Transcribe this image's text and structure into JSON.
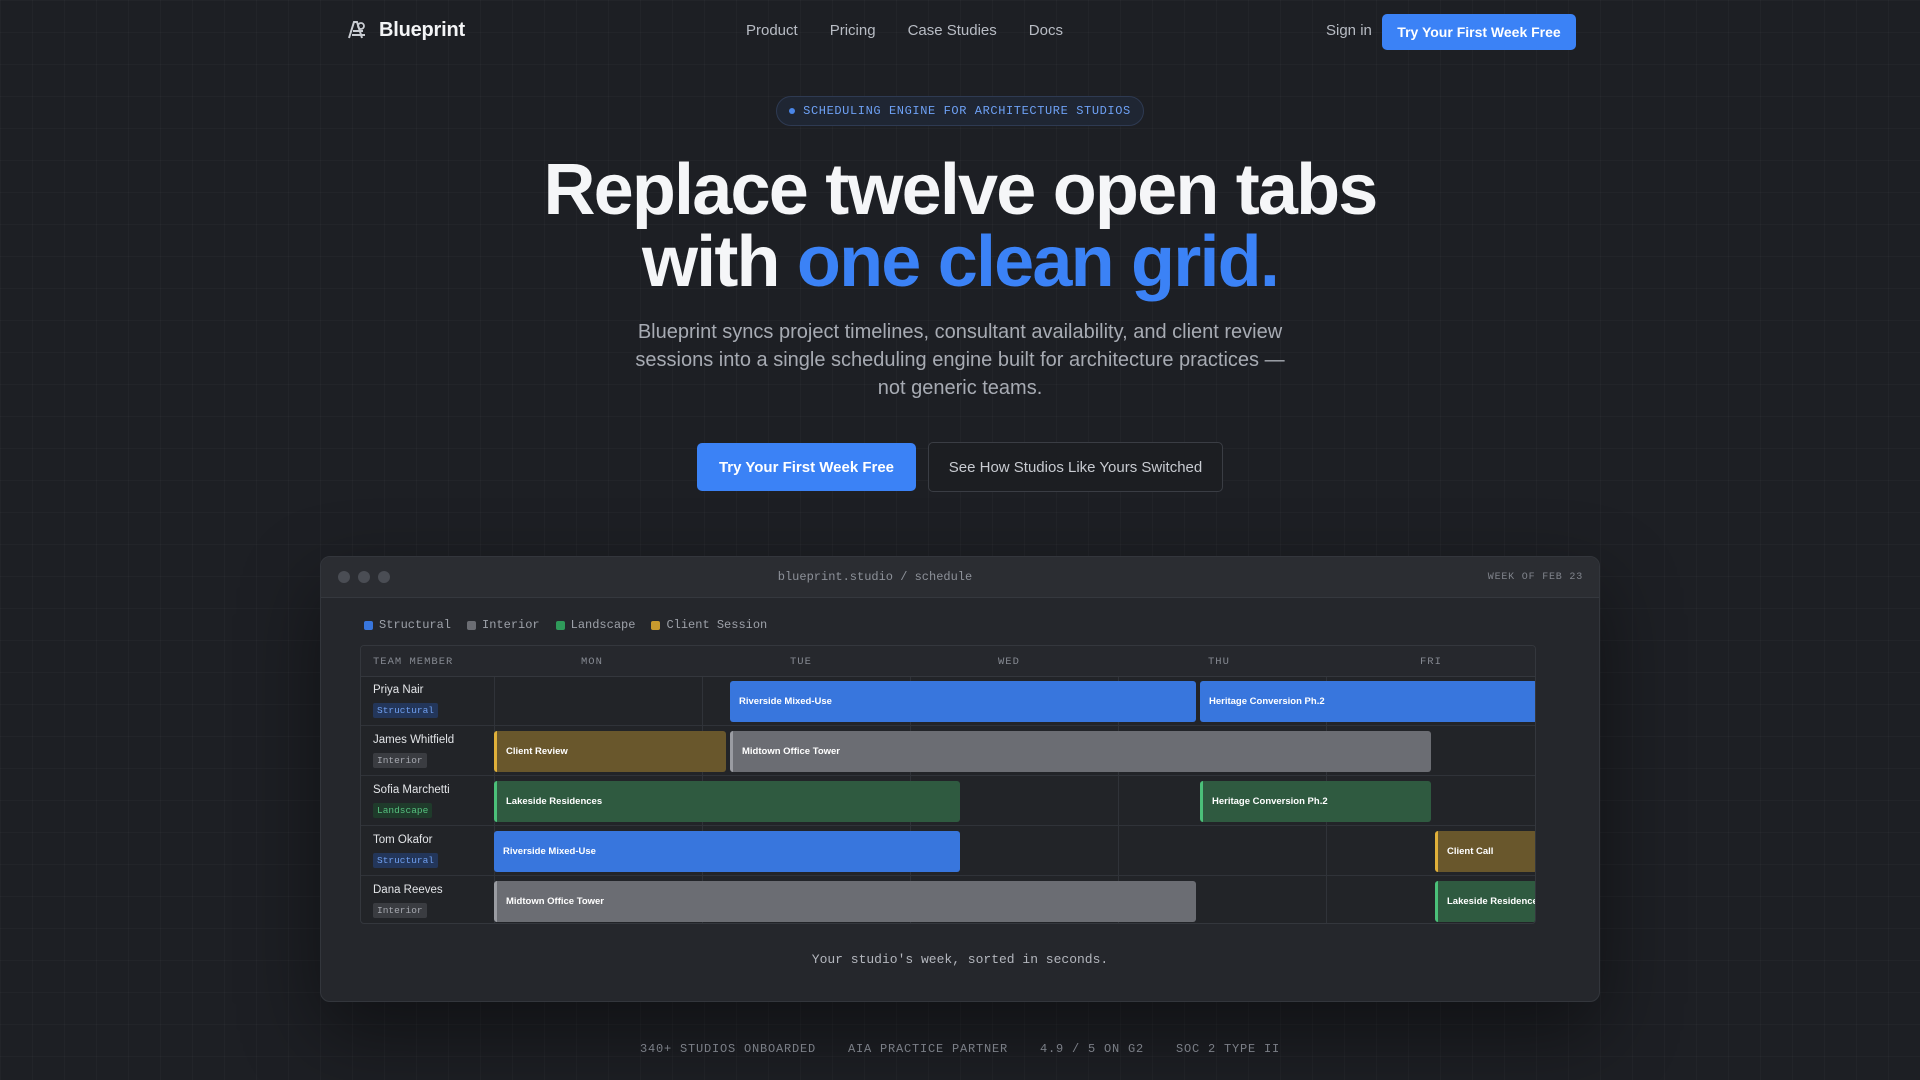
{
  "nav": {
    "brand": "Blueprint",
    "links": [
      "Product",
      "Pricing",
      "Case Studies",
      "Docs"
    ],
    "signin": "Sign in",
    "cta": "Try Your First Week Free"
  },
  "hero": {
    "pill": "SCHEDULING ENGINE FOR ARCHITECTURE STUDIOS",
    "headline_line1": "Replace twelve open tabs",
    "headline_line2_plain": "with ",
    "headline_line2_accent": "one clean grid.",
    "subhead": "Blueprint syncs project timelines, consultant availability, and client review sessions into a single scheduling engine built for architecture practices — not generic teams.",
    "cta_primary": "Try Your First Week Free",
    "cta_secondary": "See How Studios Like Yours Switched"
  },
  "app": {
    "url": "blueprint.studio / schedule",
    "week": "WEEK OF FEB 23",
    "legend": [
      "Structural",
      "Interior",
      "Landscape",
      "Client Session"
    ],
    "colors": {
      "structural": "#3876dd",
      "interior": "#6b6d73",
      "landscape": "#2f9a5a",
      "client": "#c99a2e"
    },
    "columns": {
      "member": "TEAM MEMBER",
      "days": [
        "MON",
        "TUE",
        "WED",
        "THU",
        "FRI"
      ]
    },
    "rows": [
      {
        "name": "Priya Nair",
        "tag": "Structural",
        "blocks": [
          {
            "label": "Riverside Mixed-Use",
            "type": "structural"
          },
          {
            "label": "Heritage Conversion Ph.2",
            "type": "structural"
          }
        ]
      },
      {
        "name": "James Whitfield",
        "tag": "Interior",
        "blocks": [
          {
            "label": "Client Review",
            "type": "client"
          },
          {
            "label": "Midtown Office Tower",
            "type": "interior"
          }
        ]
      },
      {
        "name": "Sofia Marchetti",
        "tag": "Landscape",
        "blocks": [
          {
            "label": "Lakeside Residences",
            "type": "landscape"
          },
          {
            "label": "Heritage Conversion Ph.2",
            "type": "landscape"
          }
        ]
      },
      {
        "name": "Tom Okafor",
        "tag": "Structural",
        "blocks": [
          {
            "label": "Riverside Mixed-Use",
            "type": "structural"
          },
          {
            "label": "Client Call",
            "type": "client"
          }
        ]
      },
      {
        "name": "Dana Reeves",
        "tag": "Interior",
        "blocks": [
          {
            "label": "Midtown Office Tower",
            "type": "interior"
          },
          {
            "label": "Lakeside Residences",
            "type": "landscape"
          }
        ]
      }
    ],
    "caption": "Your studio's week, sorted in seconds."
  },
  "stats": [
    "340+ STUDIOS ONBOARDED",
    "AIA PRACTICE PARTNER",
    "4.9 / 5 ON G2",
    "SOC 2 TYPE II"
  ]
}
